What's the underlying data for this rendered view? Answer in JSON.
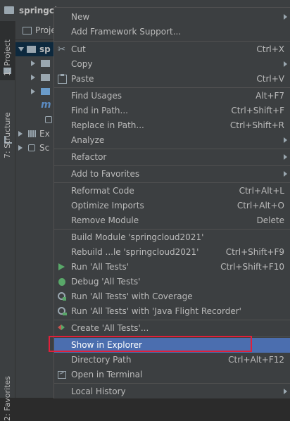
{
  "window": {
    "project_title": "springcl"
  },
  "toolwindows": {
    "project_tab": "1: Project",
    "structure_tab": "7: Structure",
    "favorites_tab": "2: Favorites"
  },
  "project_panel": {
    "title": "Proje",
    "tree": [
      {
        "label": "sp",
        "selected": true,
        "expanded": true
      },
      {
        "label": "",
        "expanded": false
      },
      {
        "label": "",
        "expanded": false
      },
      {
        "label": "",
        "expanded": false
      },
      {
        "label": "m"
      },
      {
        "label": ""
      },
      {
        "label": "Ex",
        "expanded": false
      },
      {
        "label": "Sc",
        "expanded": false
      }
    ]
  },
  "context_menu": {
    "items": [
      {
        "label": "New",
        "shortcut": "",
        "submenu": true
      },
      {
        "label": "Add Framework Support...",
        "shortcut": ""
      },
      {
        "label": "Cut",
        "shortcut": "Ctrl+X",
        "icon": "cut-icon"
      },
      {
        "label": "Copy",
        "shortcut": "",
        "submenu": true
      },
      {
        "label": "Paste",
        "shortcut": "Ctrl+V",
        "icon": "paste-icon"
      },
      {
        "label": "Find Usages",
        "shortcut": "Alt+F7"
      },
      {
        "label": "Find in Path...",
        "shortcut": "Ctrl+Shift+F"
      },
      {
        "label": "Replace in Path...",
        "shortcut": "Ctrl+Shift+R"
      },
      {
        "label": "Analyze",
        "shortcut": "",
        "submenu": true
      },
      {
        "label": "Refactor",
        "shortcut": "",
        "submenu": true
      },
      {
        "label": "Add to Favorites",
        "shortcut": "",
        "submenu": true
      },
      {
        "label": "Reformat Code",
        "shortcut": "Ctrl+Alt+L"
      },
      {
        "label": "Optimize Imports",
        "shortcut": "Ctrl+Alt+O"
      },
      {
        "label": "Remove Module",
        "shortcut": "Delete"
      },
      {
        "label": "Build Module 'springcloud2021'",
        "shortcut": ""
      },
      {
        "label": "Rebuild ...le 'springcloud2021'",
        "shortcut": "Ctrl+Shift+F9"
      },
      {
        "label": "Run 'All Tests'",
        "shortcut": "Ctrl+Shift+F10",
        "icon": "run-icon"
      },
      {
        "label": "Debug 'All Tests'",
        "shortcut": "",
        "icon": "debug-icon"
      },
      {
        "label": "Run 'All Tests' with Coverage",
        "shortcut": "",
        "icon": "coverage-icon"
      },
      {
        "label": "Run 'All Tests' with 'Java Flight Recorder'",
        "shortcut": "",
        "icon": "flight-recorder-icon"
      },
      {
        "label": "Create 'All Tests'...",
        "shortcut": "",
        "icon": "create-test-icon"
      },
      {
        "label": "Show in Explorer",
        "shortcut": "",
        "highlighted": true
      },
      {
        "label": "Directory Path",
        "shortcut": "Ctrl+Alt+F12"
      },
      {
        "label": "Open in Terminal",
        "shortcut": "",
        "icon": "terminal-icon"
      },
      {
        "label": "Local History",
        "shortcut": "",
        "submenu": true
      }
    ]
  },
  "colors": {
    "highlight": "#4b6eaf",
    "annotation_box": "#e0203a",
    "menu_bg": "#3c3f41"
  }
}
